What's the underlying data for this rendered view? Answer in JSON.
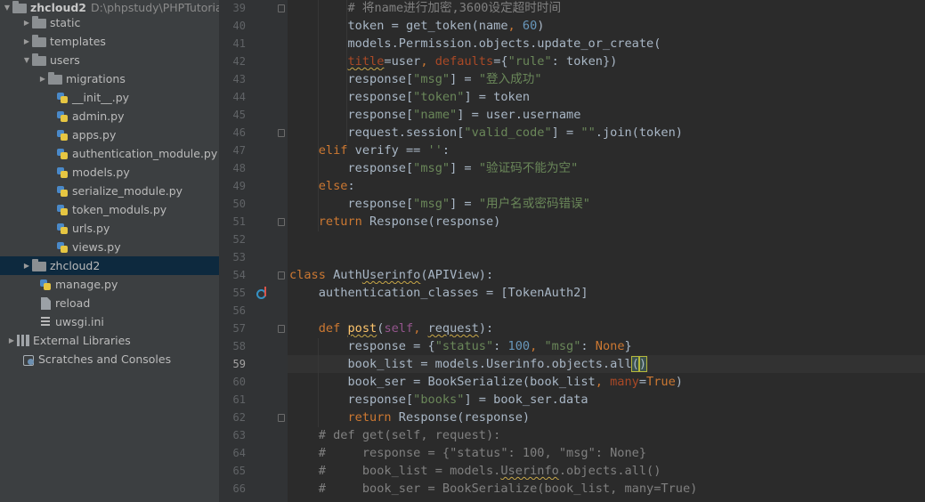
{
  "project_tree": {
    "items": [
      {
        "label": "zhcloud2",
        "path": "D:\\phpstudy\\PHPTutorial",
        "icon": "folder-icon",
        "expanded": true
      },
      {
        "label": "static",
        "icon": "folder-icon"
      },
      {
        "label": "templates",
        "icon": "folder-icon"
      },
      {
        "label": "users",
        "icon": "folder-icon",
        "expanded": true
      },
      {
        "label": "migrations",
        "icon": "folder-icon"
      },
      {
        "label": "__init__.py",
        "icon": "python-file-icon"
      },
      {
        "label": "admin.py",
        "icon": "python-file-icon"
      },
      {
        "label": "apps.py",
        "icon": "python-file-icon"
      },
      {
        "label": "authentication_module.py",
        "icon": "python-file-icon"
      },
      {
        "label": "models.py",
        "icon": "python-file-icon"
      },
      {
        "label": "serialize_module.py",
        "icon": "python-file-icon"
      },
      {
        "label": "token_moduls.py",
        "icon": "python-file-icon"
      },
      {
        "label": "urls.py",
        "icon": "python-file-icon"
      },
      {
        "label": "views.py",
        "icon": "python-file-icon"
      },
      {
        "label": "zhcloud2",
        "icon": "folder-icon",
        "selected": true
      },
      {
        "label": "manage.py",
        "icon": "python-file-icon"
      },
      {
        "label": "reload",
        "icon": "file-icon"
      },
      {
        "label": "uwsgi.ini",
        "icon": "ini-file-icon"
      },
      {
        "label": "External Libraries",
        "icon": "library-icon"
      },
      {
        "label": "Scratches and Consoles",
        "icon": "scratches-icon"
      }
    ]
  },
  "editor": {
    "current_line": "59",
    "line_numbers": [
      "39",
      "40",
      "41",
      "42",
      "43",
      "44",
      "45",
      "46",
      "47",
      "48",
      "49",
      "50",
      "51",
      "52",
      "53",
      "54",
      "55",
      "56",
      "57",
      "58",
      "59",
      "60",
      "61",
      "62",
      "63",
      "64",
      "65",
      "66"
    ],
    "lines": [
      "        # 将name进行加密,3600设定超时时间",
      "        token = get_token(name, 60)",
      "        models.Permission.objects.update_or_create(",
      "        title=user, defaults={\"rule\": token})",
      "        response[\"msg\"] = \"登入成功\"",
      "        response[\"token\"] = token",
      "        response[\"name\"] = user.username",
      "        request.session[\"valid_code\"] = \"\".join(token)",
      "    elif verify == '':",
      "        response[\"msg\"] = \"验证码不能为空\"",
      "    else:",
      "        response[\"msg\"] = \"用户名或密码错误\"",
      "    return Response(response)",
      "",
      "",
      "class AuthUserinfo(APIView):",
      "    authentication_classes = [TokenAuth2]",
      "",
      "    def post(self, request):",
      "        response = {\"status\": 100, \"msg\": None}",
      "        book_list = models.Userinfo.objects.all()",
      "        book_ser = BookSerialize(book_list, many=True)",
      "        response[\"books\"] = book_ser.data",
      "        return Response(response)",
      "    # def get(self, request):",
      "    #     response = {\"status\": 100, \"msg\": None}",
      "    #     book_list = models.Userinfo.objects.all()",
      "    #     book_ser = BookSerialize(book_list, many=True)"
    ]
  },
  "colors": {
    "keyword": "#cc7832",
    "string": "#6a8759",
    "number": "#6897bb",
    "comment": "#808080",
    "identifier": "#a9b7c6",
    "function_name": "#ffc66d",
    "self": "#94558d",
    "kwarg": "#aa4926",
    "selection": "#0d293e"
  }
}
